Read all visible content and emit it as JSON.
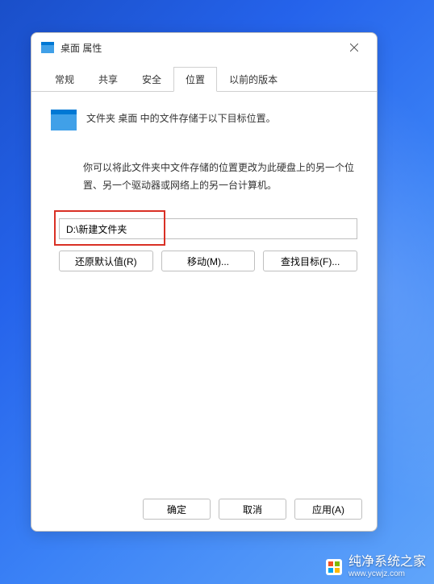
{
  "window": {
    "title": "桌面 属性"
  },
  "tabs": {
    "general": "常规",
    "share": "共享",
    "security": "安全",
    "location": "位置",
    "previous": "以前的版本"
  },
  "content": {
    "description": "文件夹 桌面 中的文件存储于以下目标位置。",
    "help_text": "你可以将此文件夹中文件存储的位置更改为此硬盘上的另一个位置、另一个驱动器或网络上的另一台计算机。",
    "path_value": "D:\\新建文件夹"
  },
  "buttons": {
    "restore_default": "还原默认值(R)",
    "move": "移动(M)...",
    "find_target": "查找目标(F)...",
    "ok": "确定",
    "cancel": "取消",
    "apply": "应用(A)"
  },
  "watermark": {
    "name": "纯净系统之家",
    "url": "www.ycwjz.com"
  }
}
